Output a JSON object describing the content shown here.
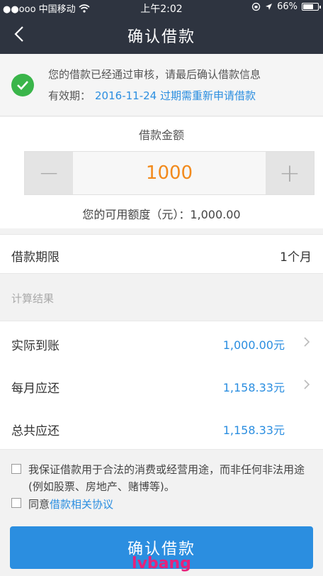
{
  "status_bar": {
    "carrier": "●●ooo 中国移动",
    "time": "上午2:02",
    "battery": "66%"
  },
  "nav": {
    "title": "确认借款"
  },
  "notice": {
    "message": "您的借款已经通过审核，请最后确认借款信息",
    "validity_label": "有效期：",
    "validity_detail": "2016-11-24 过期需重新申请借款"
  },
  "amount": {
    "label": "借款金额",
    "value": "1000",
    "minus": "−",
    "plus": "+",
    "available": "您的可用额度（元）：1,000.00"
  },
  "term": {
    "label": "借款期限",
    "value": "1个月"
  },
  "calc": {
    "header": "计算结果",
    "rows": [
      {
        "label": "实际到账",
        "value": "1,000.00元"
      },
      {
        "label": "每月应还",
        "value": "1,158.33元"
      },
      {
        "label": "总共应还",
        "value": "1,158.33元"
      }
    ]
  },
  "agreement": {
    "guarantee_text": "我保证借款用于合法的消费或经营用途，而非任何非法用途(例如股票、房地产、赌博等)。",
    "agree_prefix": "同意",
    "agree_link": "借款相关协议"
  },
  "confirm_button": "确认借款",
  "watermark": "lvbang",
  "colors": {
    "header_bg": "#2e3440",
    "accent_blue": "#2b8ee0",
    "amount_orange": "#f28a1c",
    "success_green": "#3ab54a"
  }
}
